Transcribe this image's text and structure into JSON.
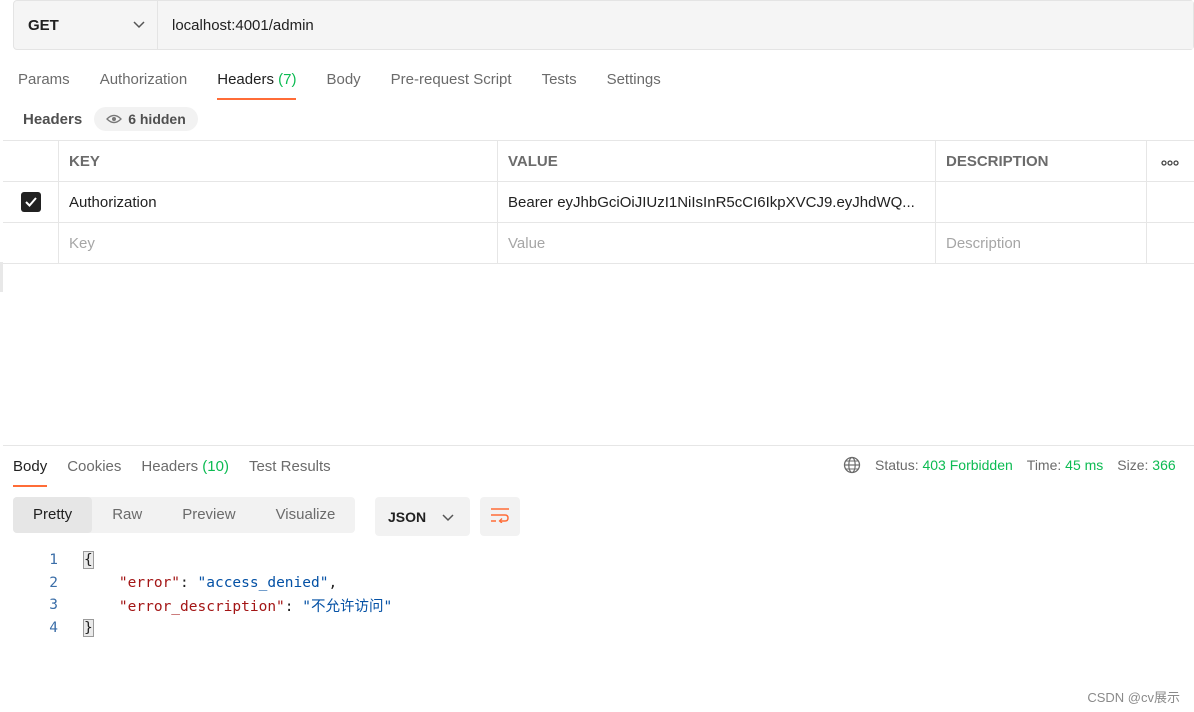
{
  "request": {
    "method": "GET",
    "url": "localhost:4001/admin"
  },
  "request_tabs": [
    {
      "label": "Params"
    },
    {
      "label": "Authorization"
    },
    {
      "label": "Headers",
      "count": "(7)"
    },
    {
      "label": "Body"
    },
    {
      "label": "Pre-request Script"
    },
    {
      "label": "Tests"
    },
    {
      "label": "Settings"
    }
  ],
  "headers_section": {
    "label": "Headers",
    "hidden_label": "6 hidden"
  },
  "table": {
    "columns": {
      "key": "KEY",
      "value": "VALUE",
      "description": "DESCRIPTION"
    },
    "rows": [
      {
        "key": "Authorization",
        "value": "Bearer  eyJhbGciOiJIUzI1NiIsInR5cCI6IkpXVCJ9.eyJhdWQ...",
        "description": "",
        "checked": true
      }
    ],
    "placeholder": {
      "key": "Key",
      "value": "Value",
      "description": "Description"
    }
  },
  "response_tabs": [
    {
      "label": "Body"
    },
    {
      "label": "Cookies"
    },
    {
      "label": "Headers",
      "count": "(10)"
    },
    {
      "label": "Test Results"
    }
  ],
  "status": {
    "status_label": "Status:",
    "status_value": "403 Forbidden",
    "time_label": "Time:",
    "time_value": "45 ms",
    "size_label": "Size:",
    "size_value": "366"
  },
  "view_modes": [
    "Pretty",
    "Raw",
    "Preview",
    "Visualize"
  ],
  "format": "JSON",
  "code_lines": [
    {
      "n": "1"
    },
    {
      "n": "2",
      "key": "\"error\"",
      "val": "\"access_denied\"",
      "trail": ","
    },
    {
      "n": "3",
      "key": "\"error_description\"",
      "val": "\"不允许访问\"",
      "trail": ""
    },
    {
      "n": "4"
    }
  ],
  "code_braces": {
    "open": "{",
    "close": "}"
  },
  "watermark": "CSDN @cv展示",
  "colors": {
    "accent": "#ff6c37",
    "success": "#0cbb52"
  }
}
